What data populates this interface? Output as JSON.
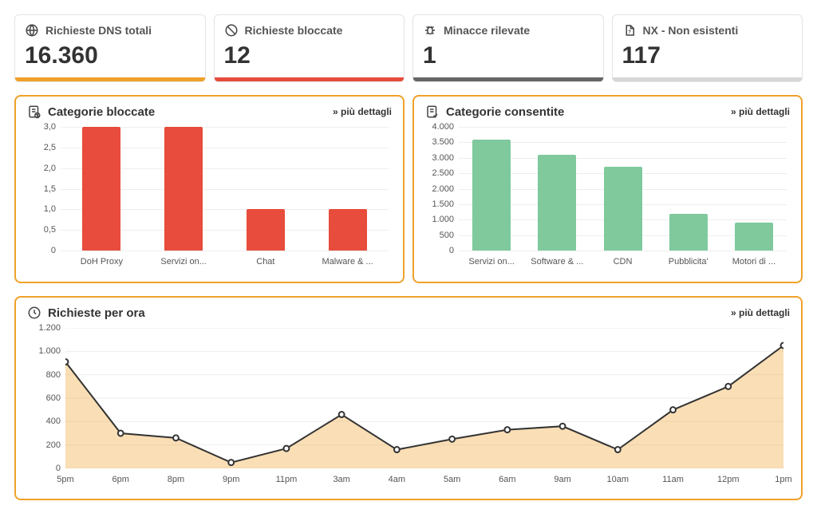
{
  "stats": {
    "total": {
      "label": "Richieste DNS totali",
      "value": "16.360",
      "color": "#f0a12a"
    },
    "blocked": {
      "label": "Richieste bloccate",
      "value": "12",
      "color": "#e74c3c"
    },
    "threats": {
      "label": "Minacce rilevate",
      "value": "1",
      "color": "#666666"
    },
    "nx": {
      "label": "NX - Non esistenti",
      "value": "117",
      "color": "#d7d7d7"
    }
  },
  "panels": {
    "blocked_cat": {
      "title": "Categorie bloccate",
      "more": "» più dettagli"
    },
    "allowed_cat": {
      "title": "Categorie consentite",
      "more": "» più dettagli"
    },
    "hourly": {
      "title": "Richieste per ora",
      "more": "» più dettagli"
    }
  },
  "chart_data": [
    {
      "id": "blocked_categories",
      "type": "bar",
      "categories": [
        "DoH Proxy",
        "Servizi on...",
        "Chat",
        "Malware & ..."
      ],
      "values": [
        3.0,
        3.0,
        1.0,
        1.0
      ],
      "ylim": [
        0,
        3.0
      ],
      "yticks": [
        0,
        0.5,
        1.0,
        1.5,
        2.0,
        2.5,
        3.0
      ],
      "ytick_labels": [
        "0",
        "0,5",
        "1,0",
        "1,5",
        "2,0",
        "2,5",
        "3,0"
      ],
      "bar_color": "#e74c3c"
    },
    {
      "id": "allowed_categories",
      "type": "bar",
      "categories": [
        "Servizi on...",
        "Software & ...",
        "CDN",
        "Pubblicita'",
        "Motori di ..."
      ],
      "values": [
        3600,
        3100,
        2700,
        1200,
        900
      ],
      "ylim": [
        0,
        4000
      ],
      "yticks": [
        0,
        500,
        1000,
        1500,
        2000,
        2500,
        3000,
        3500,
        4000
      ],
      "ytick_labels": [
        "0",
        "500",
        "1.000",
        "1.500",
        "2.000",
        "2.500",
        "3.000",
        "3.500",
        "4.000"
      ],
      "bar_color": "#7fc99d"
    },
    {
      "id": "requests_per_hour",
      "type": "area",
      "x": [
        "5pm",
        "6pm",
        "8pm",
        "9pm",
        "11pm",
        "3am",
        "4am",
        "5am",
        "6am",
        "9am",
        "10am",
        "11am",
        "12pm",
        "1pm"
      ],
      "values": [
        910,
        300,
        260,
        50,
        170,
        460,
        160,
        250,
        330,
        360,
        160,
        500,
        700,
        1050
      ],
      "ylim": [
        0,
        1200
      ],
      "yticks": [
        0,
        200,
        400,
        600,
        800,
        1000,
        1200
      ],
      "ytick_labels": [
        "0",
        "200",
        "400",
        "600",
        "800",
        "1.000",
        "1.200"
      ],
      "line_color": "#333333",
      "fill_color": "rgba(240,161,42,0.35)"
    }
  ]
}
